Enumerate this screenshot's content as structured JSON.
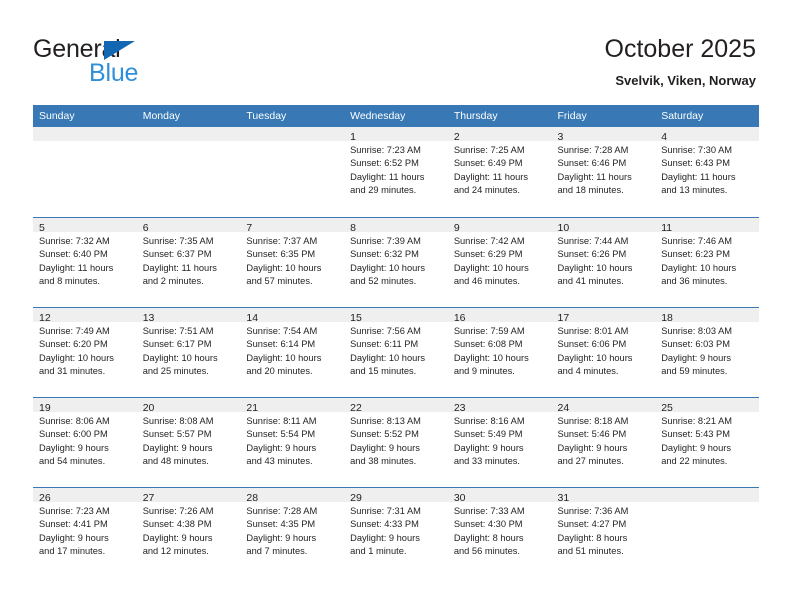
{
  "brand": {
    "name_dark": "General",
    "name_blue": "Blue",
    "triangle_color": "#1267b2",
    "blue_color": "#2f8fd8"
  },
  "header": {
    "title": "October 2025",
    "location": "Svelvik, Viken, Norway"
  },
  "theme": {
    "header_blue": "#3778b5",
    "band_gray": "#efefef",
    "text": "#231f20"
  },
  "labels": {
    "sunrise_prefix": "Sunrise:",
    "sunset_prefix": "Sunset:",
    "daylight_prefix": "Daylight:"
  },
  "weekdays": [
    "Sunday",
    "Monday",
    "Tuesday",
    "Wednesday",
    "Thursday",
    "Friday",
    "Saturday"
  ],
  "weeks": [
    [
      {
        "day": "",
        "sunrise": "",
        "sunset": "",
        "daylight_line1": "",
        "daylight_line2": ""
      },
      {
        "day": "",
        "sunrise": "",
        "sunset": "",
        "daylight_line1": "",
        "daylight_line2": ""
      },
      {
        "day": "",
        "sunrise": "",
        "sunset": "",
        "daylight_line1": "",
        "daylight_line2": ""
      },
      {
        "day": "1",
        "sunrise": "Sunrise: 7:23 AM",
        "sunset": "Sunset: 6:52 PM",
        "daylight_line1": "Daylight: 11 hours",
        "daylight_line2": "and 29 minutes."
      },
      {
        "day": "2",
        "sunrise": "Sunrise: 7:25 AM",
        "sunset": "Sunset: 6:49 PM",
        "daylight_line1": "Daylight: 11 hours",
        "daylight_line2": "and 24 minutes."
      },
      {
        "day": "3",
        "sunrise": "Sunrise: 7:28 AM",
        "sunset": "Sunset: 6:46 PM",
        "daylight_line1": "Daylight: 11 hours",
        "daylight_line2": "and 18 minutes."
      },
      {
        "day": "4",
        "sunrise": "Sunrise: 7:30 AM",
        "sunset": "Sunset: 6:43 PM",
        "daylight_line1": "Daylight: 11 hours",
        "daylight_line2": "and 13 minutes."
      }
    ],
    [
      {
        "day": "5",
        "sunrise": "Sunrise: 7:32 AM",
        "sunset": "Sunset: 6:40 PM",
        "daylight_line1": "Daylight: 11 hours",
        "daylight_line2": "and 8 minutes."
      },
      {
        "day": "6",
        "sunrise": "Sunrise: 7:35 AM",
        "sunset": "Sunset: 6:37 PM",
        "daylight_line1": "Daylight: 11 hours",
        "daylight_line2": "and 2 minutes."
      },
      {
        "day": "7",
        "sunrise": "Sunrise: 7:37 AM",
        "sunset": "Sunset: 6:35 PM",
        "daylight_line1": "Daylight: 10 hours",
        "daylight_line2": "and 57 minutes."
      },
      {
        "day": "8",
        "sunrise": "Sunrise: 7:39 AM",
        "sunset": "Sunset: 6:32 PM",
        "daylight_line1": "Daylight: 10 hours",
        "daylight_line2": "and 52 minutes."
      },
      {
        "day": "9",
        "sunrise": "Sunrise: 7:42 AM",
        "sunset": "Sunset: 6:29 PM",
        "daylight_line1": "Daylight: 10 hours",
        "daylight_line2": "and 46 minutes."
      },
      {
        "day": "10",
        "sunrise": "Sunrise: 7:44 AM",
        "sunset": "Sunset: 6:26 PM",
        "daylight_line1": "Daylight: 10 hours",
        "daylight_line2": "and 41 minutes."
      },
      {
        "day": "11",
        "sunrise": "Sunrise: 7:46 AM",
        "sunset": "Sunset: 6:23 PM",
        "daylight_line1": "Daylight: 10 hours",
        "daylight_line2": "and 36 minutes."
      }
    ],
    [
      {
        "day": "12",
        "sunrise": "Sunrise: 7:49 AM",
        "sunset": "Sunset: 6:20 PM",
        "daylight_line1": "Daylight: 10 hours",
        "daylight_line2": "and 31 minutes."
      },
      {
        "day": "13",
        "sunrise": "Sunrise: 7:51 AM",
        "sunset": "Sunset: 6:17 PM",
        "daylight_line1": "Daylight: 10 hours",
        "daylight_line2": "and 25 minutes."
      },
      {
        "day": "14",
        "sunrise": "Sunrise: 7:54 AM",
        "sunset": "Sunset: 6:14 PM",
        "daylight_line1": "Daylight: 10 hours",
        "daylight_line2": "and 20 minutes."
      },
      {
        "day": "15",
        "sunrise": "Sunrise: 7:56 AM",
        "sunset": "Sunset: 6:11 PM",
        "daylight_line1": "Daylight: 10 hours",
        "daylight_line2": "and 15 minutes."
      },
      {
        "day": "16",
        "sunrise": "Sunrise: 7:59 AM",
        "sunset": "Sunset: 6:08 PM",
        "daylight_line1": "Daylight: 10 hours",
        "daylight_line2": "and 9 minutes."
      },
      {
        "day": "17",
        "sunrise": "Sunrise: 8:01 AM",
        "sunset": "Sunset: 6:06 PM",
        "daylight_line1": "Daylight: 10 hours",
        "daylight_line2": "and 4 minutes."
      },
      {
        "day": "18",
        "sunrise": "Sunrise: 8:03 AM",
        "sunset": "Sunset: 6:03 PM",
        "daylight_line1": "Daylight: 9 hours",
        "daylight_line2": "and 59 minutes."
      }
    ],
    [
      {
        "day": "19",
        "sunrise": "Sunrise: 8:06 AM",
        "sunset": "Sunset: 6:00 PM",
        "daylight_line1": "Daylight: 9 hours",
        "daylight_line2": "and 54 minutes."
      },
      {
        "day": "20",
        "sunrise": "Sunrise: 8:08 AM",
        "sunset": "Sunset: 5:57 PM",
        "daylight_line1": "Daylight: 9 hours",
        "daylight_line2": "and 48 minutes."
      },
      {
        "day": "21",
        "sunrise": "Sunrise: 8:11 AM",
        "sunset": "Sunset: 5:54 PM",
        "daylight_line1": "Daylight: 9 hours",
        "daylight_line2": "and 43 minutes."
      },
      {
        "day": "22",
        "sunrise": "Sunrise: 8:13 AM",
        "sunset": "Sunset: 5:52 PM",
        "daylight_line1": "Daylight: 9 hours",
        "daylight_line2": "and 38 minutes."
      },
      {
        "day": "23",
        "sunrise": "Sunrise: 8:16 AM",
        "sunset": "Sunset: 5:49 PM",
        "daylight_line1": "Daylight: 9 hours",
        "daylight_line2": "and 33 minutes."
      },
      {
        "day": "24",
        "sunrise": "Sunrise: 8:18 AM",
        "sunset": "Sunset: 5:46 PM",
        "daylight_line1": "Daylight: 9 hours",
        "daylight_line2": "and 27 minutes."
      },
      {
        "day": "25",
        "sunrise": "Sunrise: 8:21 AM",
        "sunset": "Sunset: 5:43 PM",
        "daylight_line1": "Daylight: 9 hours",
        "daylight_line2": "and 22 minutes."
      }
    ],
    [
      {
        "day": "26",
        "sunrise": "Sunrise: 7:23 AM",
        "sunset": "Sunset: 4:41 PM",
        "daylight_line1": "Daylight: 9 hours",
        "daylight_line2": "and 17 minutes."
      },
      {
        "day": "27",
        "sunrise": "Sunrise: 7:26 AM",
        "sunset": "Sunset: 4:38 PM",
        "daylight_line1": "Daylight: 9 hours",
        "daylight_line2": "and 12 minutes."
      },
      {
        "day": "28",
        "sunrise": "Sunrise: 7:28 AM",
        "sunset": "Sunset: 4:35 PM",
        "daylight_line1": "Daylight: 9 hours",
        "daylight_line2": "and 7 minutes."
      },
      {
        "day": "29",
        "sunrise": "Sunrise: 7:31 AM",
        "sunset": "Sunset: 4:33 PM",
        "daylight_line1": "Daylight: 9 hours",
        "daylight_line2": "and 1 minute."
      },
      {
        "day": "30",
        "sunrise": "Sunrise: 7:33 AM",
        "sunset": "Sunset: 4:30 PM",
        "daylight_line1": "Daylight: 8 hours",
        "daylight_line2": "and 56 minutes."
      },
      {
        "day": "31",
        "sunrise": "Sunrise: 7:36 AM",
        "sunset": "Sunset: 4:27 PM",
        "daylight_line1": "Daylight: 8 hours",
        "daylight_line2": "and 51 minutes."
      },
      {
        "day": "",
        "sunrise": "",
        "sunset": "",
        "daylight_line1": "",
        "daylight_line2": ""
      }
    ]
  ]
}
